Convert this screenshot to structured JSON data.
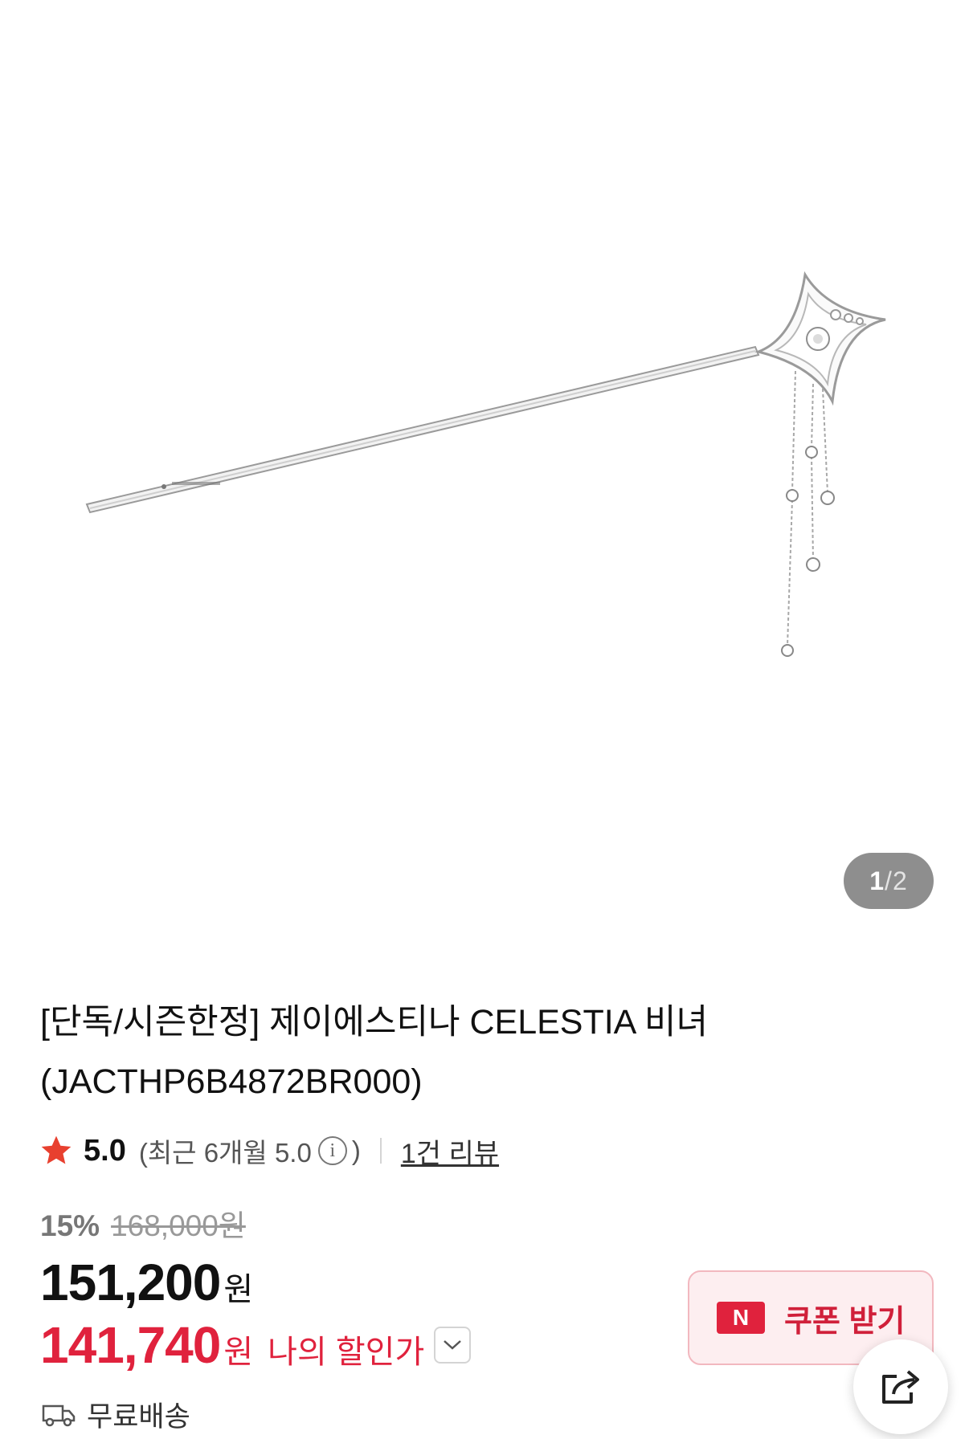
{
  "gallery": {
    "current": "1",
    "separator": "/",
    "total": "2"
  },
  "product": {
    "title_line1": "[단독/시즌한정] 제이에스티나 CELESTIA 비녀",
    "title_line2": "(JACTHP6B4872BR000)"
  },
  "rating": {
    "score": "5.0",
    "recent_prefix": "(최근 6개월 5.0",
    "recent_suffix": ")",
    "info_icon": "i",
    "reviews_link": "1건 리뷰"
  },
  "pricing": {
    "discount_rate": "15%",
    "original_price": "168,000원",
    "sale_price": "151,200",
    "sale_unit": "원",
    "my_price": "141,740",
    "my_unit": "원",
    "my_price_label": "나의 할인가"
  },
  "coupon": {
    "badge": "N",
    "label": "쿠폰 받기"
  },
  "shipping": {
    "label": "무료배송"
  },
  "colors": {
    "accent_red": "#e0223d",
    "star": "#e8402f",
    "pager_bg": "#8e8e8e"
  }
}
